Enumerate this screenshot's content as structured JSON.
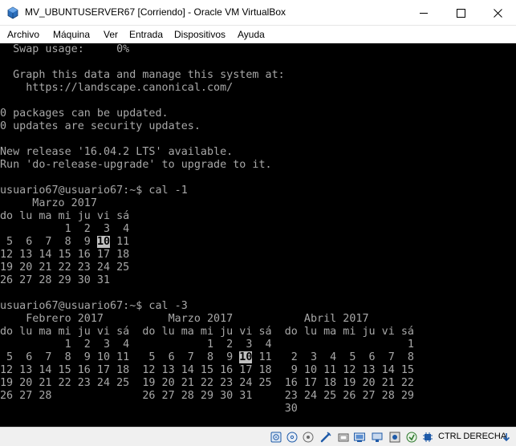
{
  "window": {
    "title": "MV_UBUNTUSERVER67 [Corriendo] - Oracle VM VirtualBox",
    "controls": {
      "minimize": "minimize",
      "maximize": "maximize",
      "close": "close"
    }
  },
  "menu": {
    "items": [
      {
        "label": "Archivo"
      },
      {
        "label": "Máquina"
      },
      {
        "label": "Ver"
      },
      {
        "label": "Entrada"
      },
      {
        "label": "Dispositivos"
      },
      {
        "label": "Ayuda"
      }
    ]
  },
  "console": {
    "lines": [
      "  Swap usage:     0%",
      "",
      "  Graph this data and manage this system at:",
      "    https://landscape.canonical.com/",
      "",
      "0 packages can be updated.",
      "0 updates are security updates.",
      "",
      "New release '16.04.2 LTS' available.",
      "Run 'do-release-upgrade' to upgrade to it.",
      "",
      "usuario67@usuario67:~$ cal -1",
      "     Marzo 2017",
      "do lu ma mi ju vi sá",
      "          1  2  3  4",
      " 5  6  7  8  9 10 11",
      "12 13 14 15 16 17 18",
      "19 20 21 22 23 24 25",
      "26 27 28 29 30 31",
      "",
      "usuario67@usuario67:~$ cal -3",
      "    Febrero 2017          Marzo 2017           Abril 2017",
      "do lu ma mi ju vi sá  do lu ma mi ju vi sá  do lu ma mi ju vi sá",
      "          1  2  3  4            1  2  3  4                     1",
      " 5  6  7  8  9 10 11   5  6  7  8  9 10 11   2  3  4  5  6  7  8",
      "12 13 14 15 16 17 18  12 13 14 15 16 17 18   9 10 11 12 13 14 15",
      "19 20 21 22 23 24 25  19 20 21 22 23 24 25  16 17 18 19 20 21 22",
      "26 27 28              26 27 28 29 30 31     23 24 25 26 27 28 29",
      "                                            30",
      "",
      "usuario67@usuario67:~$"
    ],
    "highlighted_day": "10",
    "highlight_marks": [
      {
        "line": 15,
        "col": 15
      },
      {
        "line": 24,
        "col": 37
      }
    ]
  },
  "statusbar": {
    "host_key": "CTRL DERECHA",
    "icons": [
      "hard-disk-icon",
      "optical-drive-icon",
      "audio-icon",
      "network-icon",
      "usb-icon",
      "shared-folders-icon",
      "display-icon",
      "video-capture-icon",
      "mouse-integration-icon",
      "cpu-icon",
      "arrow-down-icon"
    ]
  },
  "colors": {
    "console_bg": "#000000",
    "console_fg": "#a8a8a8",
    "highlight_bg": "#c0c0c0",
    "statusbar_bg": "#f0f0f0",
    "accent_blue": "#1e5aa8"
  }
}
